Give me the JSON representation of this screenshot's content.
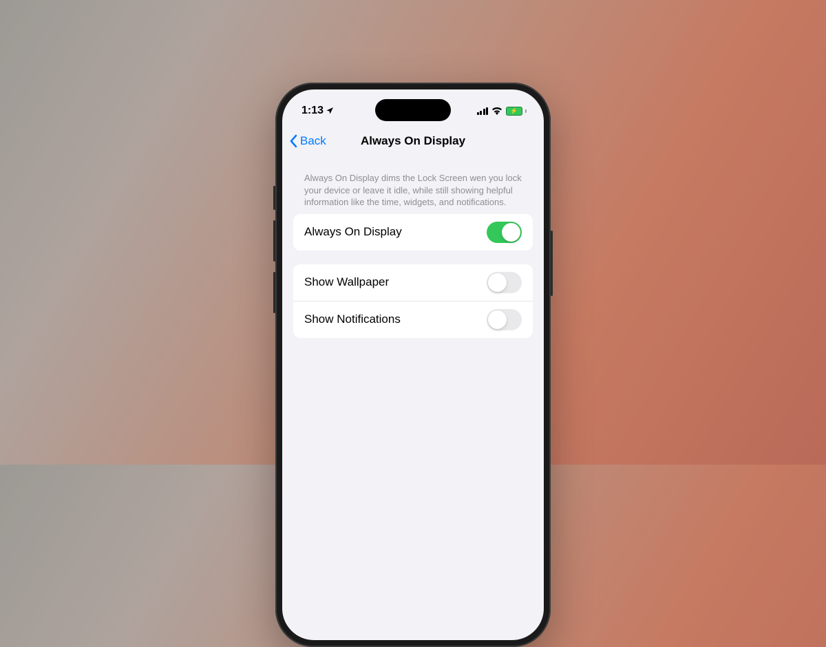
{
  "status_bar": {
    "time": "1:13"
  },
  "nav": {
    "back_label": "Back",
    "title": "Always On Display"
  },
  "description": "Always On Display dims the Lock Screen wen you lock your device or leave it idle, while still showing helpful information like the time, widgets, and notifications.",
  "groups": [
    {
      "rows": [
        {
          "label": "Always On Display",
          "on": true
        }
      ]
    },
    {
      "rows": [
        {
          "label": "Show Wallpaper",
          "on": false
        },
        {
          "label": "Show Notifications",
          "on": false
        }
      ]
    }
  ]
}
